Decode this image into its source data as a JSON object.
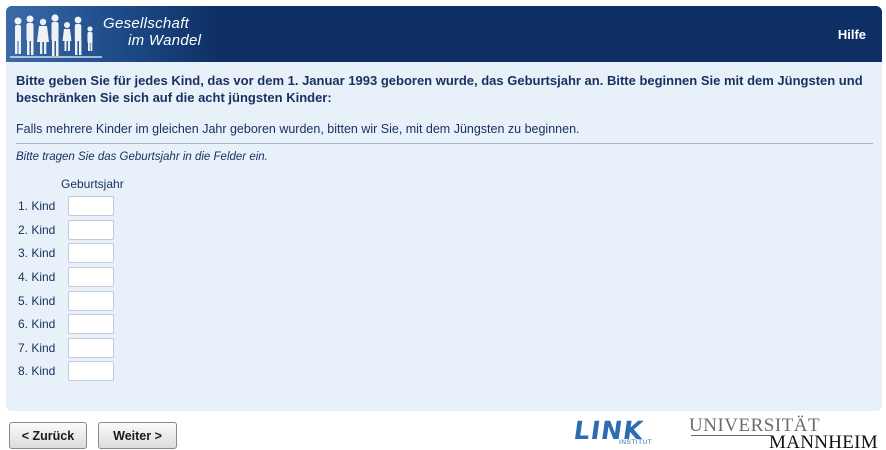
{
  "header": {
    "logo_line1": "Gesellschaft",
    "logo_line2": "im Wandel",
    "help_label": "Hilfe"
  },
  "question": {
    "text": "Bitte geben Sie für jedes Kind, das vor dem 1. Januar 1993 geboren wurde, das Geburtsjahr an. Bitte beginnen Sie mit dem Jüngsten und beschränken Sie sich auf die acht jüngsten Kinder:",
    "subtext": "Falls mehrere Kinder im gleichen Jahr geboren wurden, bitten wir Sie, mit dem Jüngsten zu beginnen.",
    "instruction": "Bitte tragen Sie das Geburtsjahr in die Felder ein.",
    "column_header": "Geburtsjahr"
  },
  "rows": [
    {
      "label": "1. Kind",
      "value": ""
    },
    {
      "label": "2. Kind",
      "value": ""
    },
    {
      "label": "3. Kind",
      "value": ""
    },
    {
      "label": "4. Kind",
      "value": ""
    },
    {
      "label": "5. Kind",
      "value": ""
    },
    {
      "label": "6. Kind",
      "value": ""
    },
    {
      "label": "7. Kind",
      "value": ""
    },
    {
      "label": "8. Kind",
      "value": ""
    }
  ],
  "nav": {
    "back_label": "< Zurück",
    "next_label": "Weiter >"
  },
  "footer": {
    "link_logo": "LINK",
    "link_sub": "INSTITUT",
    "uni_line1": "UNIVERSITÄT",
    "uni_line2": "MANNHEIM"
  },
  "colors": {
    "header_bg": "#0e2f63",
    "panel_bg": "#e8f0fa",
    "text": "#1a3160",
    "link_blue": "#2d6cb0"
  }
}
